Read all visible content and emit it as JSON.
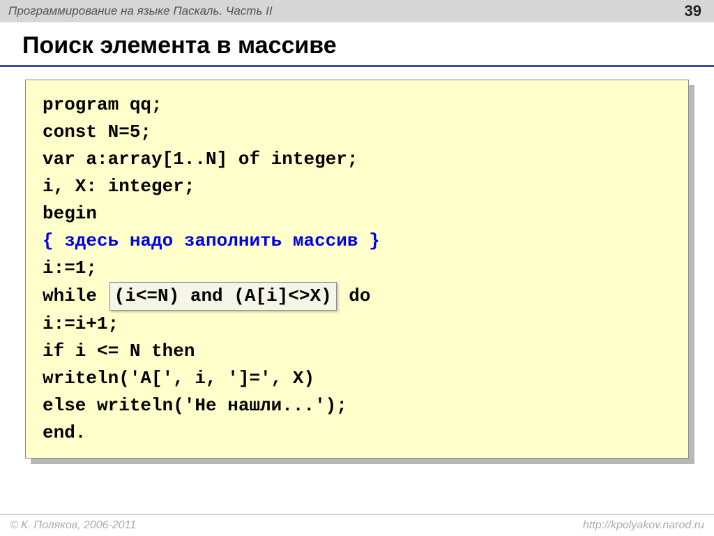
{
  "header": {
    "course_title": "Программирование на языке Паскаль. Часть II",
    "page_number": "39"
  },
  "slide": {
    "title": "Поиск элемента в массиве"
  },
  "code": {
    "line1": "program qq;",
    "line2": "const N=5;",
    "line3": "var a:array[1..N] of integer;",
    "line4": "    i, X: integer;",
    "line5": "begin",
    "comment": "  { здесь надо заполнить массив }",
    "line7": "  i:=1;",
    "line8a": "  while ",
    "line8_highlight": "(i<=N) and (A[i]<>X)",
    "line8b": " do",
    "line9": "    i:=i+1;",
    "line10": "  if i <= N then",
    "line11": "       writeln('A[', i, ']=', X)",
    "line12": "  else writeln('Не нашли...');",
    "line13": "end."
  },
  "footer": {
    "copyright": "© К. Поляков, 2006-2011",
    "url": "http://kpolyakov.narod.ru"
  }
}
